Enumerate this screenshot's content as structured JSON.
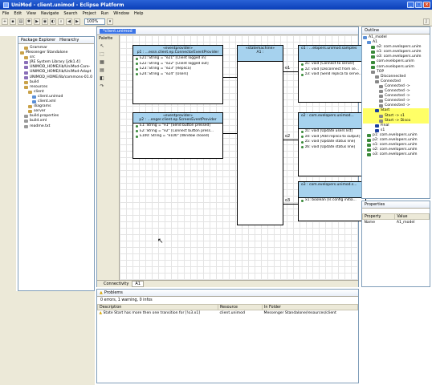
{
  "window": {
    "title": "UniMod - client.unimod - Eclipse Platform",
    "controls": [
      "_",
      "□",
      "×"
    ]
  },
  "menu": [
    "File",
    "Edit",
    "View",
    "Navigate",
    "Search",
    "Project",
    "Run",
    "Window",
    "Help"
  ],
  "toolbar": {
    "zoom": "100%"
  },
  "package_explorer": {
    "tabs": [
      "Package Explorer",
      "Hierarchy"
    ],
    "rows": [
      {
        "label": "Grammar",
        "indent": 1,
        "color": "#c9a24a"
      },
      {
        "label": "Messenger Standalone",
        "indent": 0,
        "color": "#c9a24a"
      },
      {
        "label": "src",
        "indent": 1,
        "color": "#c9a24a"
      },
      {
        "label": "JRE System Library [jdk1.4]",
        "indent": 1,
        "color": "#8a6fb8"
      },
      {
        "label": "UNIMOD_HOME/lib/UniMod-Core-",
        "indent": 1,
        "color": "#8a6fb8"
      },
      {
        "label": "UNIMOD_HOME/lib/UniMod-Adapt",
        "indent": 1,
        "color": "#8a6fb8"
      },
      {
        "label": "UNIMOD_HOME/lib/commons-01.0",
        "indent": 1,
        "color": "#8a6fb8"
      },
      {
        "label": "build",
        "indent": 1,
        "color": "#c9a24a"
      },
      {
        "label": "resources",
        "indent": 1,
        "color": "#c9a24a"
      },
      {
        "label": "client",
        "indent": 2,
        "color": "#c9a24a"
      },
      {
        "label": "client.unimod",
        "indent": 3,
        "color": "#5b8fd6"
      },
      {
        "label": "client.xml",
        "indent": 3,
        "color": "#5b8fd6"
      },
      {
        "label": "diagrams",
        "indent": 2,
        "color": "#c9a24a"
      },
      {
        "label": "server",
        "indent": 2,
        "color": "#c9a24a"
      },
      {
        "label": "build.properties",
        "indent": 1,
        "color": "#9a9a9a"
      },
      {
        "label": "build.xml",
        "indent": 1,
        "color": "#9a9a9a"
      },
      {
        "label": "readme.txt",
        "indent": 1,
        "color": "#9a9a9a"
      }
    ]
  },
  "editor": {
    "tab": "*client.unimod",
    "palette_label": "Palette",
    "bottom_tabs": [
      "Connectivity",
      "A1"
    ],
    "ep1": {
      "stereo": "«eventprovider»",
      "name": "p1 : ...essn.client.ep.ConnectorEventProvider",
      "rows": [
        "E21: String = \"e21\" [Client logged in]",
        "E22: String = \"e22\" [Client logged out]",
        "E23: String = \"e23\" [Replica]",
        "E24: String = \"e24\" [Users]"
      ]
    },
    "ep2": {
      "stereo": "«eventprovider»",
      "name": "p2 : ...enger.client.ep.ScreenEventProvider",
      "rows": [
        "E1: String = \"e1\" [Send button pressed]",
        "E2: String = \"e2\" [Connect button press...",
        "E100: String = \"e100\" [Window closed]"
      ]
    },
    "sm": {
      "stereo": "«statemachine»",
      "name": "A1 :"
    },
    "o1": {
      "title": "o1 : ...elopers.unimod.samples",
      "rows": [
        "z1: void [Connect to server]",
        "z2: void [Disconnect from se...",
        "z3: void [Send replica to serve..."
      ]
    },
    "o2": {
      "title": "o2 : com.evelopers.unimod...",
      "rows": [
        "z1: void [Update users list]",
        "z4: void [Add replica to output]",
        "z5: void [Update status line]",
        "z6: void [Update status line]"
      ]
    },
    "o3": {
      "title": "o3 : com.evelopers.unimod.s...",
      "rows": [
        "x1: boolean [Is config initia..."
      ]
    },
    "edge_labels": [
      "o1",
      "o2",
      "o3"
    ]
  },
  "outline": {
    "tab": "Outline",
    "rows": [
      {
        "label": "A1_model",
        "indent": 0,
        "color": "#5b8fd6"
      },
      {
        "label": "A1",
        "indent": 1,
        "color": "#5b8fd6"
      },
      {
        "label": "o2: com.evelopers.unim",
        "indent": 2,
        "color": "#3a8a3a"
      },
      {
        "label": "o1: com.evelopers.unim",
        "indent": 2,
        "color": "#3a8a3a"
      },
      {
        "label": "o3: com.evelopers.unim",
        "indent": 2,
        "color": "#3a8a3a"
      },
      {
        "label": "com.evelopers.unim",
        "indent": 2,
        "color": "#3a8a3a"
      },
      {
        "label": "com.evelopers.unim",
        "indent": 2,
        "color": "#3a8a3a"
      },
      {
        "label": "TOP",
        "indent": 2,
        "color": "#888888"
      },
      {
        "label": "Disconnected",
        "indent": 3,
        "color": "#888888"
      },
      {
        "label": "Connected",
        "indent": 3,
        "color": "#888888"
      },
      {
        "label": "Connected ->",
        "indent": 4,
        "color": "#888888"
      },
      {
        "label": "Connected ->",
        "indent": 4,
        "color": "#888888"
      },
      {
        "label": "Connected ->",
        "indent": 4,
        "color": "#888888"
      },
      {
        "label": "Connected ->",
        "indent": 4,
        "color": "#888888"
      },
      {
        "label": "Connected ->",
        "indent": 4,
        "color": "#888888"
      },
      {
        "label": "Start",
        "indent": 3,
        "color": "#1a3fa0",
        "highlight": true
      },
      {
        "label": "Start -> s1",
        "indent": 4,
        "color": "#888888",
        "highlight": true
      },
      {
        "label": "Start -> Disco",
        "indent": 4,
        "color": "#888888",
        "highlight": true
      },
      {
        "label": "Final",
        "indent": 3,
        "color": "#1a3fa0"
      },
      {
        "label": "s1",
        "indent": 3,
        "color": "#1a3fa0"
      },
      {
        "label": "p1: com.evelopers.unim",
        "indent": 1,
        "color": "#3a8a3a"
      },
      {
        "label": "p2: com.evelopers.unim",
        "indent": 1,
        "color": "#3a8a3a"
      },
      {
        "label": "o1: com.evelopers.unim",
        "indent": 1,
        "color": "#3a8a3a"
      },
      {
        "label": "o2: com.evelopers.unim",
        "indent": 1,
        "color": "#3a8a3a"
      },
      {
        "label": "o3: com.evelopers.unim",
        "indent": 1,
        "color": "#3a8a3a"
      }
    ]
  },
  "properties": {
    "tab": "Properties",
    "headers": [
      "Property",
      "Value"
    ],
    "rows": [
      [
        "Name",
        "A1_model"
      ]
    ]
  },
  "problems": {
    "tab": "Problems",
    "summary": "0 errors, 1 warning, 0 infos",
    "headers": [
      "Description",
      "Resource",
      "In Folder"
    ],
    "rows": [
      [
        "State Start has more then one transition for [!o3.x1]",
        "client.unimod",
        "Messenger Standalone/resources/client"
      ]
    ]
  }
}
